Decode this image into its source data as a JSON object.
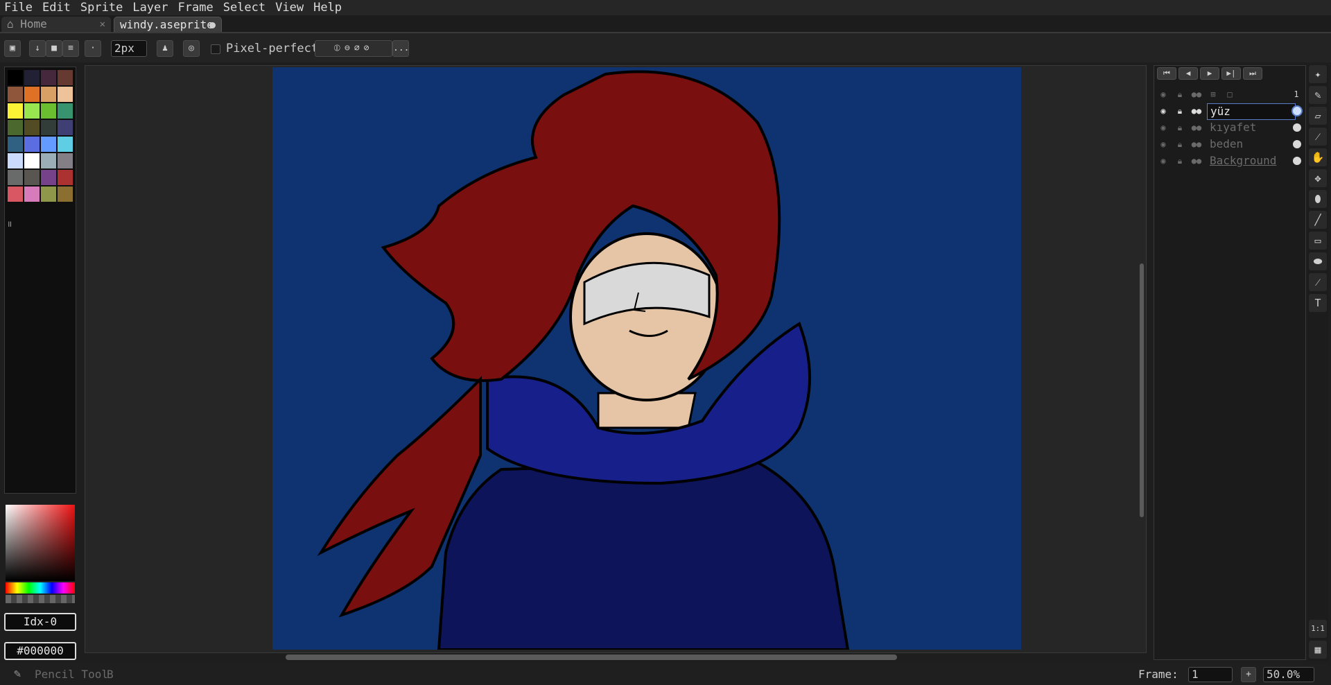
{
  "menu": [
    "File",
    "Edit",
    "Sprite",
    "Layer",
    "Frame",
    "Select",
    "View",
    "Help"
  ],
  "tabs": {
    "home": {
      "label": "Home",
      "icon": "home-icon"
    },
    "file": {
      "label": "windy.aseprite"
    }
  },
  "toolbar": {
    "brush_size": "2px",
    "pixel_perfect_label": "Pixel-perfect",
    "more_label": "..."
  },
  "palette": {
    "colors": [
      "#000000",
      "#222034",
      "#45283c",
      "#663931",
      "#8f563b",
      "#df7126",
      "#d9a066",
      "#eec39a",
      "#fbf236",
      "#99e550",
      "#6abe30",
      "#37946e",
      "#4b692f",
      "#524b24",
      "#323c39",
      "#3f3f74",
      "#306082",
      "#5b6ee1",
      "#639bff",
      "#5fcde4",
      "#cbdbfc",
      "#ffffff",
      "#9badb7",
      "#847e87",
      "#696a6a",
      "#595652",
      "#76428a",
      "#ac3232",
      "#d95763",
      "#d77bba",
      "#8f974a",
      "#8a6f30"
    ],
    "index_label": "Idx-0",
    "hex_label": "#000000"
  },
  "canvas": {
    "background": "#0f3371",
    "hair": "#7a0f0f",
    "skin": "#e6c4a6",
    "scarf": "#17208a",
    "hoodie": "#0d145a"
  },
  "timeline": {
    "frame_header": "1",
    "layers": [
      {
        "name": "yüz",
        "active": true
      },
      {
        "name": "kıyafet",
        "active": false
      },
      {
        "name": "beden",
        "active": false
      },
      {
        "name": "Background",
        "active": false
      }
    ]
  },
  "status": {
    "tool": "Pencil Tool",
    "tool_extra": "B",
    "frame_label": "Frame:",
    "frame_value": "1",
    "zoom": "50.0%"
  },
  "zoom_buttons": {
    "one_to_one": "1:1"
  }
}
